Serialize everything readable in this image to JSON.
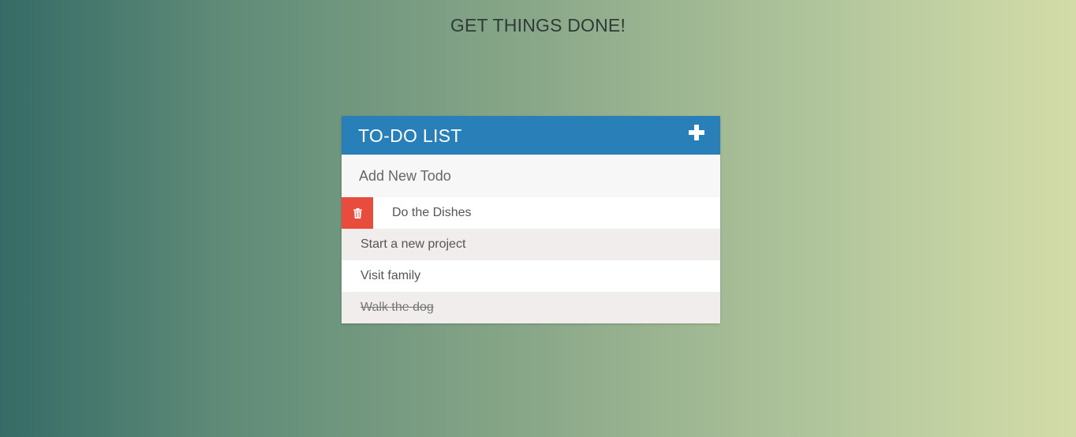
{
  "page": {
    "title": "GET THINGS DONE!"
  },
  "card": {
    "title": "TO-DO LIST",
    "add_icon": "plus-icon",
    "accent_color": "#2980b9"
  },
  "new_todo": {
    "placeholder": "Add New Todo",
    "value": ""
  },
  "todos": [
    {
      "text": "Do the Dishes",
      "completed": false,
      "hovered": true,
      "delete_icon": "trash-icon"
    },
    {
      "text": "Start a new project",
      "completed": false,
      "hovered": false
    },
    {
      "text": "Visit family",
      "completed": false,
      "hovered": false
    },
    {
      "text": "Walk the dog",
      "completed": true,
      "hovered": false
    }
  ],
  "colors": {
    "delete": "#e74c3c",
    "row_alt": "#f0edec",
    "input_bg": "#f7f7f7"
  }
}
